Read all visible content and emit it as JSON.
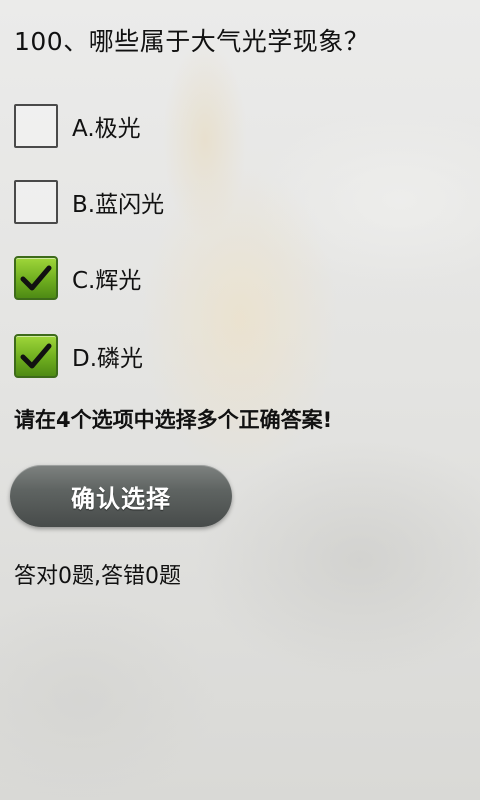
{
  "question": {
    "title": "100、哪些属于大气光学现象？"
  },
  "options": [
    {
      "label": "A.极光",
      "checked": false
    },
    {
      "label": "B.蓝闪光",
      "checked": false
    },
    {
      "label": "C.辉光",
      "checked": true
    },
    {
      "label": "D.磷光",
      "checked": true
    }
  ],
  "hint": "请在4个选项中选择多个正确答案!",
  "confirm_button": "确认选择",
  "score": "答对0题,答错0题",
  "colors": {
    "check_green": "#6fae1f",
    "button_gray": "#5f6462"
  }
}
